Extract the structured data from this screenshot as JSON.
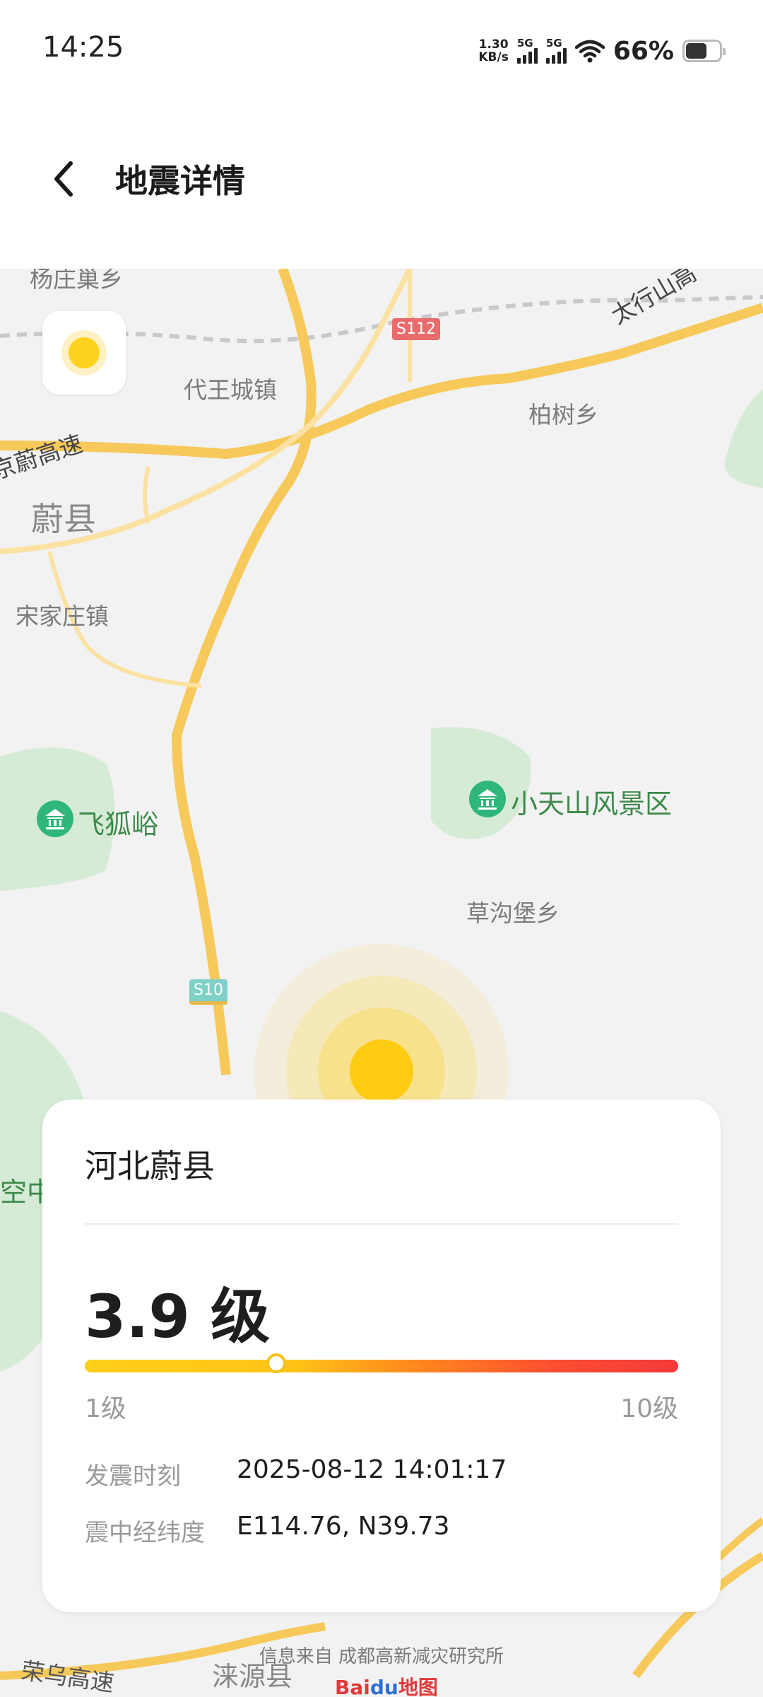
{
  "status_bar": {
    "time": "14:25",
    "net_speed_value": "1.30",
    "net_speed_unit": "KB/s",
    "signal1_label": "5G",
    "signal2_label": "5G",
    "battery_percent": "66%",
    "battery_level": 0.66
  },
  "header": {
    "title": "地震详情"
  },
  "map": {
    "labels": {
      "yangzhuangchao": "杨庄巢乡",
      "taihang": "太行山高",
      "daiwangcheng": "代王城镇",
      "baishu": "柏树乡",
      "yuwei_highway": "京蔚高速",
      "yuxian": "蔚县",
      "songjiazhuang": "宋家庄镇",
      "feihuyu": "飞狐峪",
      "xiaotianshan": "小天山风景区",
      "caogoubao": "草沟堡乡",
      "kongzhong": "空中",
      "rongwu": "荣乌高速",
      "laiyuan": "涞源县"
    },
    "road_badges": {
      "s10": "S10",
      "s112": "S112"
    },
    "attribution": "信息来自 成都高新减灾研究所",
    "provider_logo_a": "Bai",
    "provider_logo_b": "du",
    "provider_logo_c": "地图",
    "colors": {
      "epicenter": "#ffd21f",
      "road": "#f6c95a",
      "park": "#cfe8d2"
    }
  },
  "card": {
    "location": "河北蔚县",
    "magnitude_text": "3.9 级",
    "magnitude_value": 3.9,
    "scale_min": "1级",
    "scale_max": "10级",
    "time_label": "发震时刻",
    "time_value": "2025-08-12 14:01:17",
    "coords_label": "震中经纬度",
    "coords_value": "E114.76, N39.73"
  }
}
